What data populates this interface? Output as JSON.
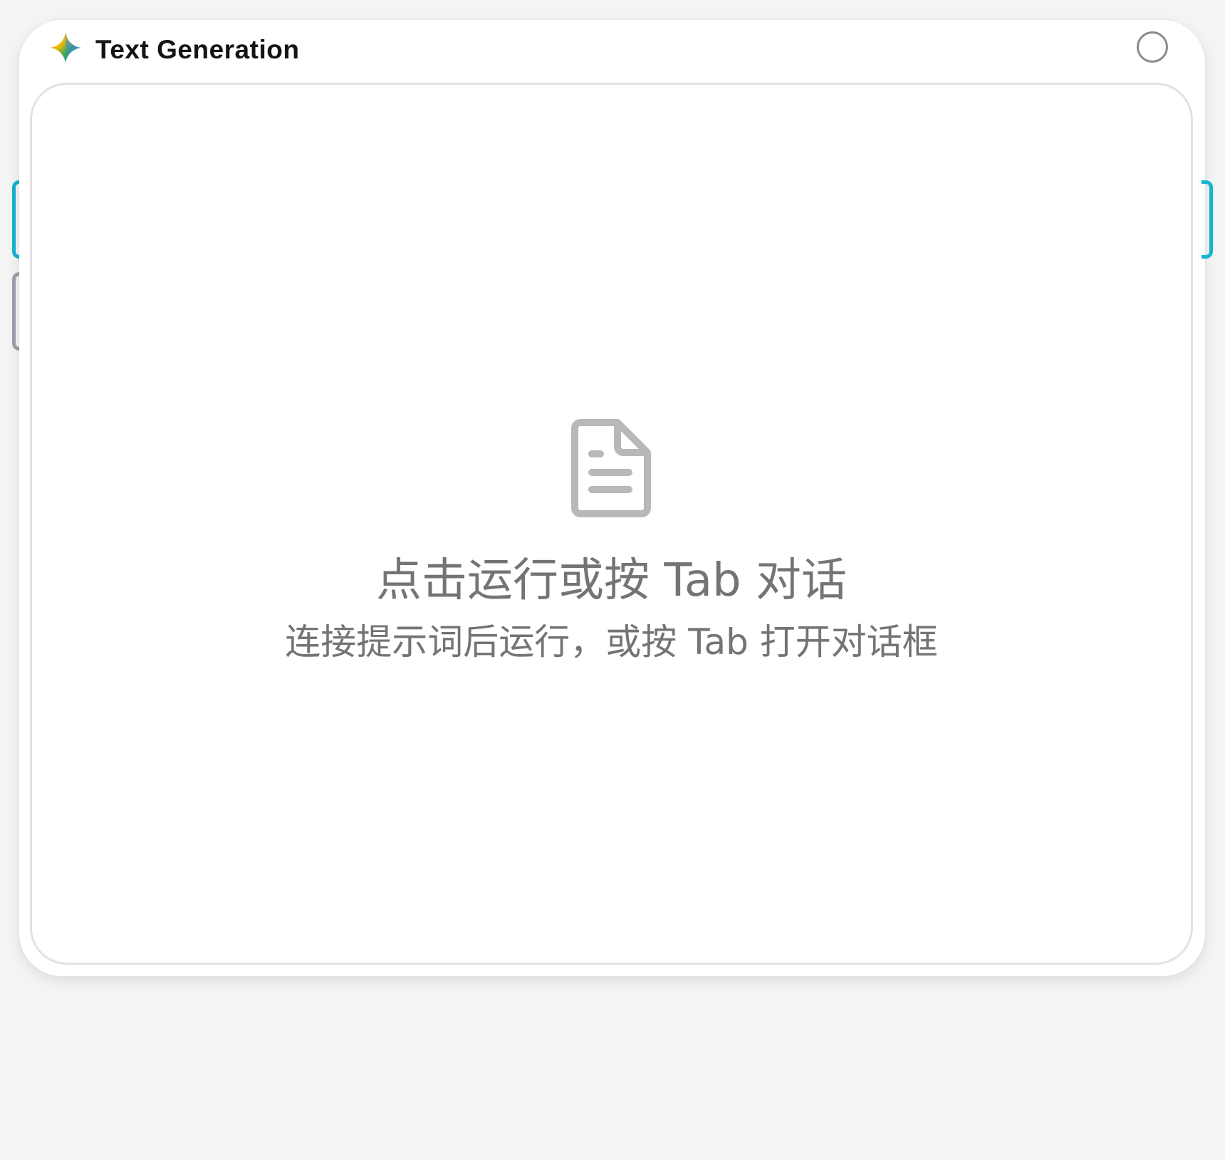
{
  "node": {
    "title": "Text Generation",
    "icon": "gemini-sparkle-icon",
    "status_icon": "status-circle-icon"
  },
  "output": {
    "empty_icon": "document-icon",
    "empty_title": "点击运行或按 Tab 对话",
    "empty_subtitle": "连接提示词后运行，或按 Tab 打开对话框"
  },
  "handles": {
    "left_input_color": "#12b4cf",
    "left_secondary_color": "#9aa1ad",
    "right_output_color": "#12b4cf"
  },
  "colors": {
    "background": "#f4f4f4",
    "card": "#ffffff",
    "muted_text": "#747474",
    "icon_gray": "#b8b8b8"
  }
}
